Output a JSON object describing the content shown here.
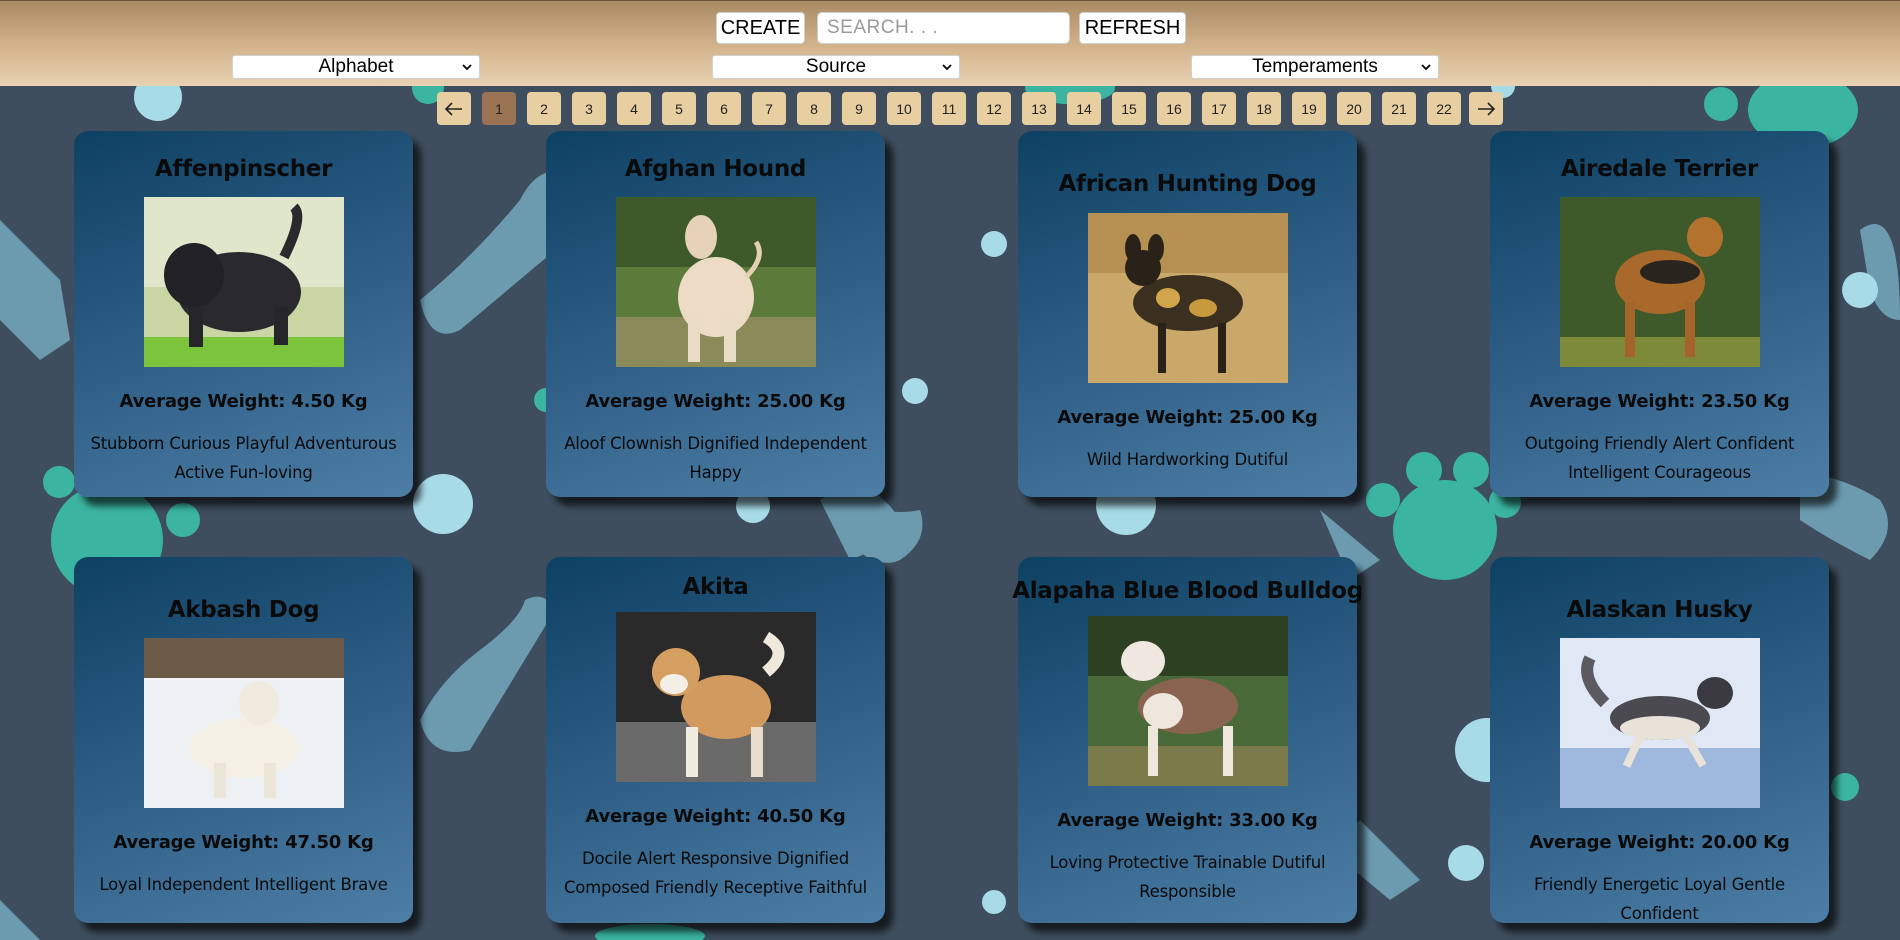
{
  "header": {
    "create_label": "CREATE",
    "search_placeholder": "SEARCH. . .",
    "search_value": "",
    "refresh_label": "REFRESH",
    "filters": {
      "alphabet": "Alphabet",
      "source": "Source",
      "temperaments": "Temperaments"
    }
  },
  "pagination": {
    "pages": [
      "1",
      "2",
      "3",
      "4",
      "5",
      "6",
      "7",
      "8",
      "9",
      "10",
      "11",
      "12",
      "13",
      "14",
      "15",
      "16",
      "17",
      "18",
      "19",
      "20",
      "21",
      "22"
    ],
    "current": "1",
    "prev_icon": "arrow-left-icon",
    "next_icon": "arrow-right-icon"
  },
  "colors": {
    "background": "#3e4e5e",
    "header_top": "#a88a64",
    "header_bottom": "#e8d2b2",
    "page_button": "#e8cfa2",
    "page_button_active": "#9a7452",
    "card_dark": "#0d4163",
    "card_light": "#4d7ea6",
    "decor_teal": "#3bb5a1",
    "decor_lightblue": "#a8dbe8",
    "decor_steel": "#6f9fb4"
  },
  "cards": [
    {
      "name": "Affenpinscher",
      "weight": "Average Weight: 4.50 Kg",
      "temperament": "Stubborn Curious Playful Adventurous Active Fun-loving",
      "image": "black shaggy dog on grass"
    },
    {
      "name": "Afghan Hound",
      "weight": "Average Weight: 25.00 Kg",
      "temperament": "Aloof Clownish Dignified Independent Happy",
      "image": "cream long-haired hound in park"
    },
    {
      "name": "African Hunting Dog",
      "weight": "Average Weight: 25.00 Kg",
      "temperament": "Wild Hardworking Dutiful",
      "image": "spotted wild dog in dry grass"
    },
    {
      "name": "Airedale Terrier",
      "weight": "Average Weight: 23.50 Kg",
      "temperament": "Outgoing Friendly Alert Confident Intelligent Courageous",
      "image": "tan terrier before ivy hedge"
    },
    {
      "name": "Akbash Dog",
      "weight": "Average Weight: 47.50 Kg",
      "temperament": "Loyal Independent Intelligent Brave",
      "image": "white dog in snow"
    },
    {
      "name": "Akita",
      "weight": "Average Weight: 40.50 Kg",
      "temperament": "Docile Alert Responsive Dignified Composed Friendly Receptive Faithful",
      "image": "red and white akita on pavement"
    },
    {
      "name": "Alapaha Blue Blood Bulldog",
      "weight": "Average Weight: 33.00 Kg",
      "temperament": "Loving Protective Trainable Dutiful Responsible",
      "image": "brown and white bulldog on leash"
    },
    {
      "name": "Alaskan Husky",
      "weight": "Average Weight: 20.00 Kg",
      "temperament": "Friendly Energetic Loyal Gentle Confident",
      "image": "husky running in snow"
    }
  ]
}
